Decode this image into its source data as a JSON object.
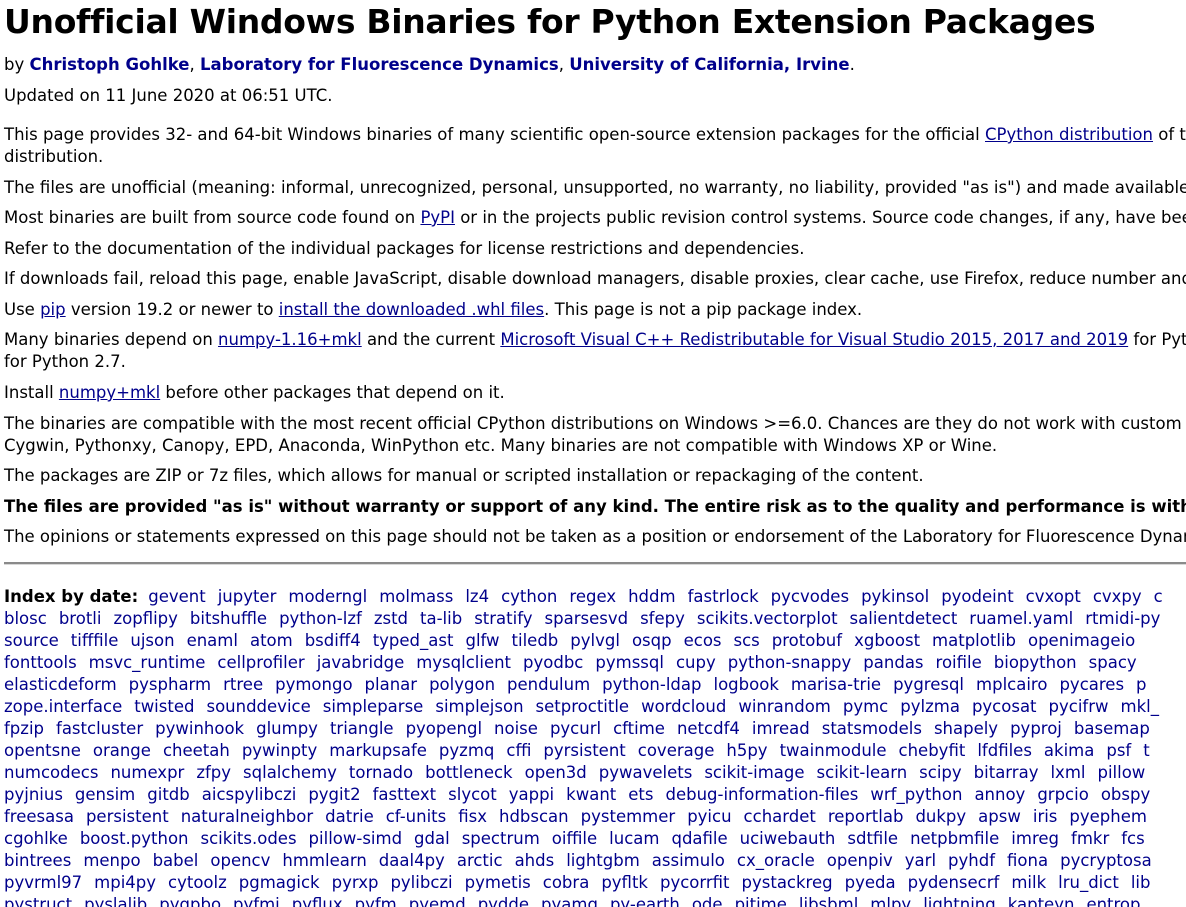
{
  "title": "Unofficial Windows Binaries for Python Extension Packages",
  "byline": {
    "prefix": "by ",
    "author": "Christoph Gohlke",
    "sep1": ", ",
    "lab": "Laboratory for Fluorescence Dynamics",
    "sep2": ", ",
    "university": "University of California, Irvine",
    "suffix": "."
  },
  "updated": "Updated on 11 June 2020 at 06:51 UTC.",
  "p1": {
    "before": "This page provides 32- and 64-bit Windows binaries of many scientific open-source extension packages for the official ",
    "link": "CPython distribution",
    "after": " of th",
    "line2": "distribution."
  },
  "p2": "The files are unofficial (meaning: informal, unrecognized, personal, unsupported, no warranty, no liability, provided \"as is\") and made available fo",
  "p3": {
    "before": "Most binaries are built from source code found on ",
    "link": "PyPI",
    "after": " or in the projects public revision control systems. Source code changes, if any, have been"
  },
  "p4": "Refer to the documentation of the individual packages for license restrictions and dependencies.",
  "p5": "If downloads fail, reload this page, enable JavaScript, disable download managers, disable proxies, clear cache, use Firefox, reduce number and f",
  "p6": {
    "before": "Use ",
    "link1": "pip",
    "middle": " version 19.2 or newer to ",
    "link2": "install the downloaded .whl files",
    "after": ". This page is not a pip package index."
  },
  "p7": {
    "before": "Many binaries depend on ",
    "link1": "numpy-1.16+mkl",
    "middle": " and the current ",
    "link2": "Microsoft Visual C++ Redistributable for Visual Studio 2015, 2017 and 2019",
    "after": " for Pyth",
    "line2": "for Python 2.7."
  },
  "p8": {
    "before": "Install ",
    "link": "numpy+mkl",
    "after": " before other packages that depend on it."
  },
  "p9": {
    "line1": "The binaries are compatible with the most recent official CPython distributions on Windows >=6.0. Chances are they do not work with custom P",
    "line2": "Cygwin, Pythonxy, Canopy, EPD, Anaconda, WinPython etc. Many binaries are not compatible with Windows XP or Wine."
  },
  "p10": "The packages are ZIP or 7z files, which allows for manual or scripted installation or repackaging of the content.",
  "p11": "The files are provided \"as is\" without warranty or support of any kind. The entire risk as to the quality and performance is with you.",
  "p12": "The opinions or statements expressed on this page should not be taken as a position or endorsement of the Laboratory for Fluorescence Dynam",
  "index": {
    "label": "Index by date:",
    "rows": [
      [
        "gevent",
        "jupyter",
        "moderngl",
        "molmass",
        "lz4",
        "cython",
        "regex",
        "hddm",
        "fastrlock",
        "pycvodes",
        "pykinsol",
        "pyodeint",
        "cvxopt",
        "cvxpy",
        "c"
      ],
      [
        "blosc",
        "brotli",
        "zopflipy",
        "bitshuffle",
        "python-lzf",
        "zstd",
        "ta-lib",
        "stratify",
        "sparsesvd",
        "sfepy",
        "scikits.vectorplot",
        "salientdetect",
        "ruamel.yaml",
        "rtmidi-py"
      ],
      [
        "source",
        "tifffile",
        "ujson",
        "enaml",
        "atom",
        "bsdiff4",
        "typed_ast",
        "glfw",
        "tiledb",
        "pylvgl",
        "osqp",
        "ecos",
        "scs",
        "protobuf",
        "xgboost",
        "matplotlib",
        "openimageio"
      ],
      [
        "fonttools",
        "msvc_runtime",
        "cellprofiler",
        "javabridge",
        "mysqlclient",
        "pyodbc",
        "pymssql",
        "cupy",
        "python-snappy",
        "pandas",
        "roifile",
        "biopython",
        "spacy",
        ""
      ],
      [
        "elasticdeform",
        "pyspharm",
        "rtree",
        "pymongo",
        "planar",
        "polygon",
        "pendulum",
        "python-ldap",
        "logbook",
        "marisa-trie",
        "pygresql",
        "mplcairo",
        "pycares",
        "p"
      ],
      [
        "zope.interface",
        "twisted",
        "sounddevice",
        "simpleparse",
        "simplejson",
        "setproctitle",
        "wordcloud",
        "winrandom",
        "pymc",
        "pylzma",
        "pycosat",
        "pycifrw",
        "mkl_"
      ],
      [
        "fpzip",
        "fastcluster",
        "pywinhook",
        "glumpy",
        "triangle",
        "pyopengl",
        "noise",
        "pycurl",
        "cftime",
        "netcdf4",
        "imread",
        "statsmodels",
        "shapely",
        "pyproj",
        "basemap"
      ],
      [
        "opentsne",
        "orange",
        "cheetah",
        "pywinpty",
        "markupsafe",
        "pyzmq",
        "cffi",
        "pyrsistent",
        "coverage",
        "h5py",
        "twainmodule",
        "chebyfit",
        "lfdfiles",
        "akima",
        "psf",
        "t"
      ],
      [
        "numcodecs",
        "numexpr",
        "zfpy",
        "sqlalchemy",
        "tornado",
        "bottleneck",
        "open3d",
        "pywavelets",
        "scikit-image",
        "scikit-learn",
        "scipy",
        "bitarray",
        "lxml",
        "pillow"
      ],
      [
        "pyjnius",
        "gensim",
        "gitdb",
        "aicspylibczi",
        "pygit2",
        "fasttext",
        "slycot",
        "yappi",
        "kwant",
        "ets",
        "debug-information-files",
        "wrf_python",
        "annoy",
        "grpcio",
        "obspy"
      ],
      [
        "freesasa",
        "persistent",
        "naturalneighbor",
        "datrie",
        "cf-units",
        "fisx",
        "hdbscan",
        "pystemmer",
        "pyicu",
        "cchardet",
        "reportlab",
        "dukpy",
        "apsw",
        "iris",
        "pyephem"
      ],
      [
        "cgohlke",
        "boost.python",
        "scikits.odes",
        "pillow-simd",
        "gdal",
        "spectrum",
        "oiffile",
        "lucam",
        "qdafile",
        "uciwebauth",
        "sdtfile",
        "netpbmfile",
        "imreg",
        "fmkr",
        "fcs"
      ],
      [
        "bintrees",
        "menpo",
        "babel",
        "opencv",
        "hmmlearn",
        "daal4py",
        "arctic",
        "ahds",
        "lightgbm",
        "assimulo",
        "cx_oracle",
        "openpiv",
        "yarl",
        "pyhdf",
        "fiona",
        "pycryptosa"
      ],
      [
        "pyvrml97",
        "mpi4py",
        "cytoolz",
        "pgmagick",
        "pyrxp",
        "pylibczi",
        "pymetis",
        "cobra",
        "pyfltk",
        "pycorrfit",
        "pystackreg",
        "pyeda",
        "pydensecrf",
        "milk",
        "lru_dict",
        "lib"
      ],
      [
        "pystruct",
        "pyslalib",
        "pygpbo",
        "pyfmi",
        "pyflux",
        "pyfm",
        "pyemd",
        "pydde",
        "pyamg",
        "py-earth",
        "ode",
        "pitime",
        "libsbml",
        "mlpy",
        "lightning",
        "kapteyn",
        "entrop"
      ]
    ]
  }
}
